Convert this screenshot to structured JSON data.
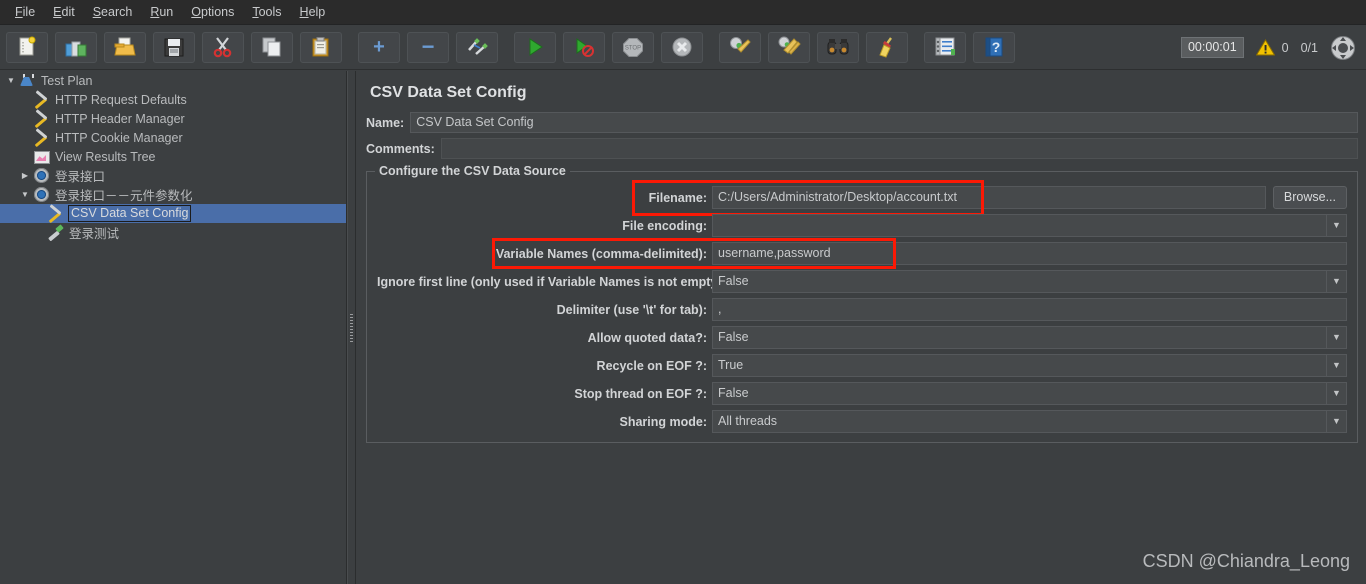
{
  "app": {
    "title": "CSV Data Set Config",
    "watermark": "CSDN @Chiandra_Leong"
  },
  "menubar": {
    "items": [
      {
        "name": "file",
        "mnemonic": "F",
        "rest": "ile"
      },
      {
        "name": "edit",
        "mnemonic": "E",
        "rest": "dit"
      },
      {
        "name": "search",
        "mnemonic": "S",
        "rest": "earch"
      },
      {
        "name": "run",
        "mnemonic": "R",
        "rest": "un"
      },
      {
        "name": "options",
        "mnemonic": "O",
        "rest": "ptions"
      },
      {
        "name": "tools",
        "mnemonic": "T",
        "rest": "ools"
      },
      {
        "name": "help",
        "mnemonic": "H",
        "rest": "elp"
      }
    ]
  },
  "toolbar": {
    "buttons": [
      {
        "name": "new-icon",
        "glyph": "new"
      },
      {
        "name": "templates-icon",
        "glyph": "templates"
      },
      {
        "name": "open-icon",
        "glyph": "open"
      },
      {
        "name": "save-icon",
        "glyph": "save"
      },
      {
        "name": "cut-icon",
        "glyph": "cut"
      },
      {
        "name": "copy-icon",
        "glyph": "copy"
      },
      {
        "name": "paste-icon",
        "glyph": "paste"
      },
      {
        "name": "expand-all-icon",
        "glyph": "plus"
      },
      {
        "name": "collapse-all-icon",
        "glyph": "minus"
      },
      {
        "name": "toggle-icon",
        "glyph": "toggle"
      },
      {
        "name": "start-icon",
        "glyph": "play"
      },
      {
        "name": "start-no-pauses-icon",
        "glyph": "play-no-pause"
      },
      {
        "name": "stop-icon",
        "glyph": "stop"
      },
      {
        "name": "shutdown-icon",
        "glyph": "shutdown"
      },
      {
        "name": "clear-icon",
        "glyph": "clear"
      },
      {
        "name": "clear-all-icon",
        "glyph": "clear-all"
      },
      {
        "name": "search-icon",
        "glyph": "binoculars"
      },
      {
        "name": "search-reset-icon",
        "glyph": "broom"
      },
      {
        "name": "function-helper-icon",
        "glyph": "function-helper"
      },
      {
        "name": "help-icon",
        "glyph": "help"
      }
    ],
    "status": {
      "timer": "00:00:01",
      "warnings": "0",
      "threads": "0/1"
    }
  },
  "tree": {
    "nodes": [
      {
        "label": "Test Plan",
        "icon": "testplan",
        "indent": 0,
        "twisty": "down",
        "selected": false
      },
      {
        "label": "HTTP Request Defaults",
        "icon": "wrench",
        "indent": 1,
        "twisty": "none",
        "selected": false
      },
      {
        "label": "HTTP Header Manager",
        "icon": "wrench",
        "indent": 1,
        "twisty": "none",
        "selected": false
      },
      {
        "label": "HTTP Cookie Manager",
        "icon": "wrench",
        "indent": 1,
        "twisty": "none",
        "selected": false
      },
      {
        "label": "View Results Tree",
        "icon": "results",
        "indent": 1,
        "twisty": "none",
        "selected": false
      },
      {
        "label": "登录接口",
        "icon": "gear",
        "indent": 1,
        "twisty": "right",
        "selected": false
      },
      {
        "label": "登录接口－－元件参数化",
        "icon": "gear",
        "indent": 1,
        "twisty": "down",
        "selected": false
      },
      {
        "label": "CSV Data Set Config",
        "icon": "wrench",
        "indent": 2,
        "twisty": "none",
        "selected": true
      },
      {
        "label": "登录测试",
        "icon": "pipette",
        "indent": 2,
        "twisty": "none",
        "selected": false
      }
    ]
  },
  "main": {
    "title": "CSV Data Set Config",
    "name_label": "Name:",
    "name_value": "CSV Data Set Config",
    "comments_label": "Comments:",
    "comments_value": "",
    "group_legend": "Configure the CSV Data Source",
    "browse_label": "Browse...",
    "fields": [
      {
        "name": "filename",
        "label": "Filename:",
        "value": "C:/Users/Administrator/Desktop/account.txt",
        "kind": "text",
        "highlight": true,
        "browse": true
      },
      {
        "name": "file-encoding",
        "label": "File encoding:",
        "value": "",
        "kind": "combo",
        "highlight": false,
        "browse": false
      },
      {
        "name": "variable-names",
        "label": "Variable Names (comma-delimited):",
        "value": "username,password",
        "kind": "text",
        "highlight": true,
        "browse": false
      },
      {
        "name": "ignore-first-line",
        "label": "Ignore first line (only used if Variable Names is not empty):",
        "value": "False",
        "kind": "combo",
        "highlight": false,
        "browse": false
      },
      {
        "name": "delimiter",
        "label": "Delimiter (use '\\t' for tab):",
        "value": ",",
        "kind": "text",
        "highlight": false,
        "browse": false
      },
      {
        "name": "allow-quoted-data",
        "label": "Allow quoted data?:",
        "value": "False",
        "kind": "combo",
        "highlight": false,
        "browse": false
      },
      {
        "name": "recycle-on-eof",
        "label": "Recycle on EOF ?:",
        "value": "True",
        "kind": "combo",
        "highlight": false,
        "browse": false
      },
      {
        "name": "stop-thread-on-eof",
        "label": "Stop thread on EOF ?:",
        "value": "False",
        "kind": "combo",
        "highlight": false,
        "browse": false
      },
      {
        "name": "sharing-mode",
        "label": "Sharing mode:",
        "value": "All threads",
        "kind": "combo",
        "highlight": false,
        "browse": false
      }
    ]
  },
  "colors": {
    "background": "#3c3f41",
    "menubar": "#2b2b2b",
    "selection": "#4a6ea9",
    "highlight": "#fc1905",
    "text": "#c8cacc"
  }
}
